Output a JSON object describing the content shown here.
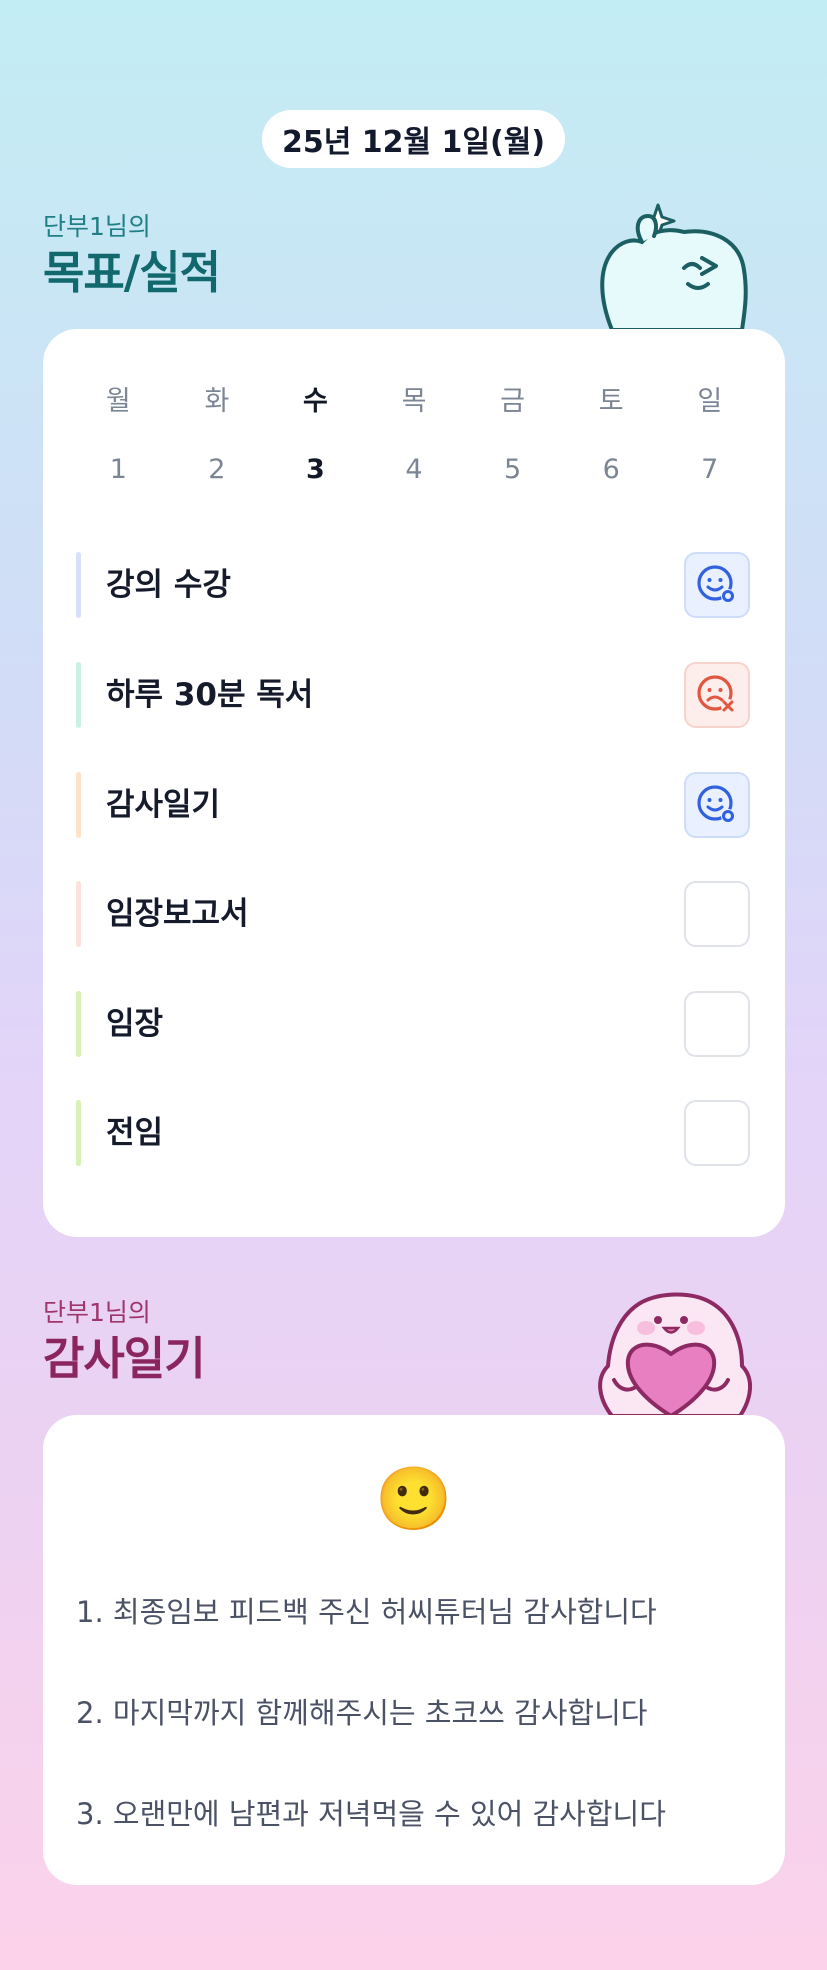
{
  "date": "25년 12월 1일(월)",
  "goals_section": {
    "subtitle": "단부1님의",
    "title": "목표/실적"
  },
  "week": {
    "days": [
      "월",
      "화",
      "수",
      "목",
      "금",
      "토",
      "일"
    ],
    "dates": [
      "1",
      "2",
      "3",
      "4",
      "5",
      "6",
      "7"
    ],
    "selected_day": "수"
  },
  "goals": [
    {
      "label": "강의 수강",
      "bar_color": "#d6e1fb",
      "status": "achieved",
      "icon": "smile-check-icon"
    },
    {
      "label": "하루 30분 독서",
      "bar_color": "#c9f2e3",
      "status": "failed",
      "icon": "frown-x-icon"
    },
    {
      "label": "감사일기",
      "bar_color": "#fde3c6",
      "status": "achieved",
      "icon": "smile-check-icon"
    },
    {
      "label": "임장보고서",
      "bar_color": "#fde1dc",
      "status": "empty",
      "icon": ""
    },
    {
      "label": "임장",
      "bar_color": "#d8f1b4",
      "status": "empty",
      "icon": ""
    },
    {
      "label": "전임",
      "bar_color": "#d8f1b4",
      "status": "empty",
      "icon": ""
    }
  ],
  "diary_section": {
    "subtitle": "단부1님의",
    "title": "감사일기"
  },
  "diary": {
    "mood": "🙂",
    "entries": [
      "1. 최종임보 피드백 주신 허씨튜터님 감사합니다",
      "2. 마지막까지 함께해주시는 초코쓰 감사합니다",
      "3. 오랜만에 남편과 저녁먹을 수 있어 감사합니다"
    ]
  },
  "colors": {
    "achieved": "#3160e0",
    "failed": "#e2553f",
    "goal_title": "#11686d",
    "diary_title": "#8a2560"
  }
}
